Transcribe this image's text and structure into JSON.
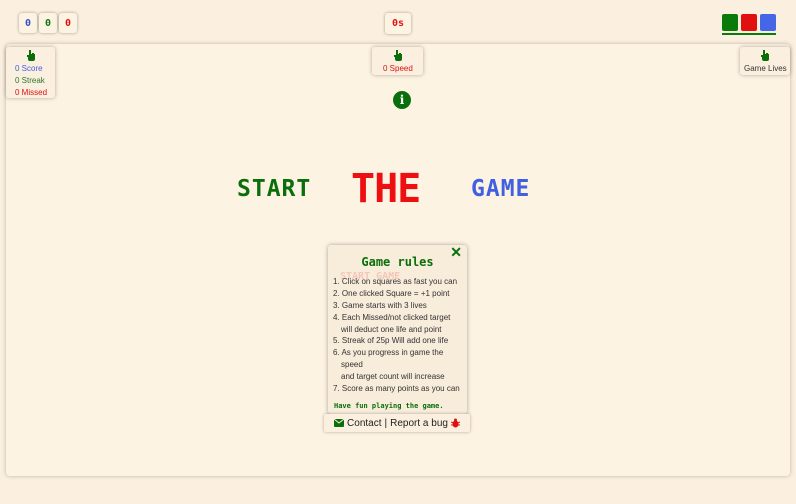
{
  "top_bar": {
    "lives_indicators": [
      "0",
      "0",
      "0"
    ],
    "timer": "0s"
  },
  "colors": {
    "green": "#0a7a0a",
    "red": "#e01010",
    "blue": "#4566e6",
    "background": "#fbf0e0"
  },
  "stats": {
    "score": "0 Score",
    "streak": "0 Streak",
    "missed": "0 Missed"
  },
  "speed": {
    "label": "0 Speed"
  },
  "lives_panel": {
    "label": "Game Lives"
  },
  "headline": {
    "word1": "START",
    "word2": "THE",
    "word3": "GAME"
  },
  "rules": {
    "title": "Game rules",
    "close": "✕",
    "items": [
      "1. Click on squares as fast you can",
      "2. One clicked Square = +1 point",
      "3. Game starts with 3 lives",
      "4. Each Missed/not clicked target",
      "    will deduct one life and point",
      "5. Streak of 25p Will add one life",
      "6. As you progress in game the",
      "    speed",
      "    and target count will increase",
      "7. Score as many points as you can"
    ],
    "footer": "Have fun playing the game."
  },
  "footer": {
    "contact": "Contact",
    "separator": "|",
    "report": "Report a bug"
  },
  "icons": [
    "hand-pointer-icon",
    "info-icon",
    "close-icon",
    "envelope-icon",
    "bug-icon"
  ]
}
